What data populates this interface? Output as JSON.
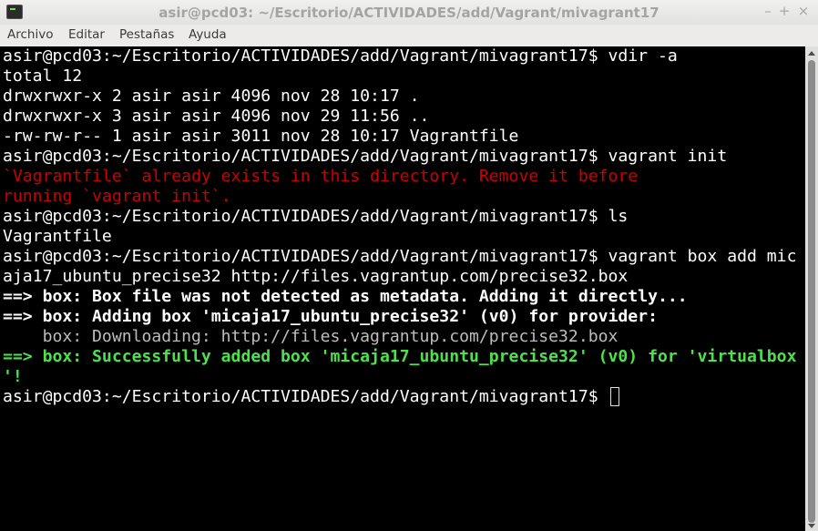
{
  "window": {
    "title": "asir@pcd03: ~/Escritorio/ACTIVIDADES/add/Vagrant/mivagrant17",
    "buttons": {
      "minimize": "–",
      "maximize": "+",
      "close": "×"
    },
    "icon": "terminal-icon"
  },
  "menu": [
    "Archivo",
    "Editar",
    "Pestañas",
    "Ayuda"
  ],
  "terminal": {
    "lines": [
      "asir@pcd03:~/Escritorio/ACTIVIDADES/add/Vagrant/mivagrant17$ vdir -a",
      "total 12",
      "drwxrwxr-x 2 asir asir 4096 nov 28 10:17 .",
      "drwxrwxr-x 3 asir asir 4096 nov 29 11:56 ..",
      "-rw-rw-r-- 1 asir asir 3011 nov 28 10:17 Vagrantfile",
      "asir@pcd03:~/Escritorio/ACTIVIDADES/add/Vagrant/mivagrant17$ vagrant init",
      "`Vagrantfile` already exists in this directory. Remove it before",
      "running `vagrant init`.",
      "asir@pcd03:~/Escritorio/ACTIVIDADES/add/Vagrant/mivagrant17$ ls",
      "Vagrantfile",
      "asir@pcd03:~/Escritorio/ACTIVIDADES/add/Vagrant/mivagrant17$ vagrant box add mic",
      "aja17_ubuntu_precise32 http://files.vagrantup.com/precise32.box",
      "==> box: Box file was not detected as metadata. Adding it directly...",
      "==> box: Adding box 'micaja17_ubuntu_precise32' (v0) for provider:",
      "    box: Downloading: http://files.vagrantup.com/precise32.box",
      "==> box: Successfully added box 'micaja17_ubuntu_precise32' (v0) for 'virtualbox",
      "'!",
      "asir@pcd03:~/Escritorio/ACTIVIDADES/add/Vagrant/mivagrant17$ "
    ],
    "colors": {
      "background": "#000000",
      "text": "#ffffff",
      "error": "#cc0000",
      "success": "#4ee14e"
    }
  }
}
